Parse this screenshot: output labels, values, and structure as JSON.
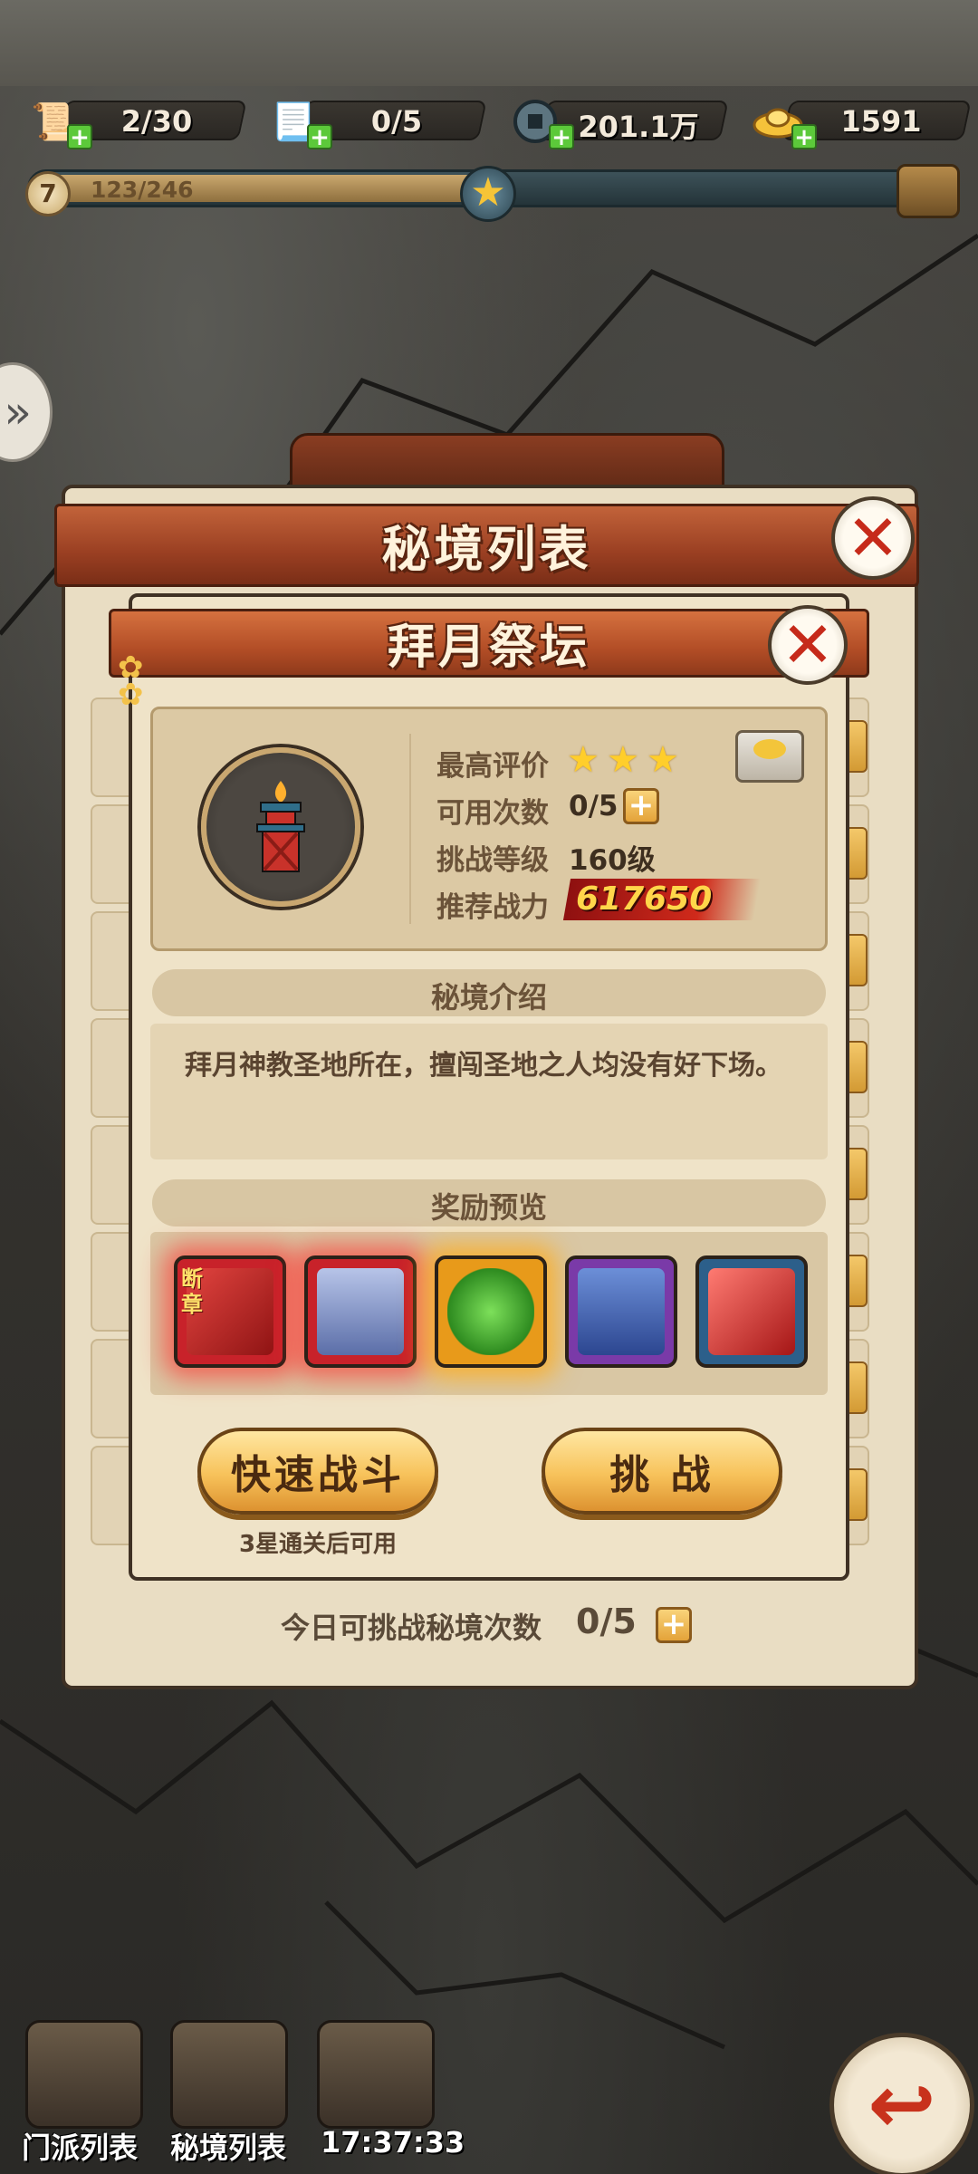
{
  "resources": [
    {
      "icon": "stamina-scroll-icon",
      "value": "2/30"
    },
    {
      "icon": "challenge-scroll-icon",
      "value": "0/5"
    },
    {
      "icon": "copper-coin-icon",
      "value": "201.1万"
    },
    {
      "icon": "gold-ingot-icon",
      "value": "1591"
    }
  ],
  "progress": {
    "level": "7",
    "text": "123/246",
    "fraction": 0.5
  },
  "outer_panel": {
    "title": "秘境列表",
    "daily_label": "今日可挑战秘境次数",
    "daily_count": "0/5"
  },
  "inner_panel": {
    "title": "拜月祭坛",
    "info": {
      "best_rating_label": "最高评价",
      "best_rating_stars": 3,
      "uses_label": "可用次数",
      "uses_value": "0/5",
      "level_label": "挑战等级",
      "level_value": "160级",
      "power_label": "推荐战力",
      "power_value": "617650"
    },
    "intro_title": "秘境介绍",
    "intro_text": "拜月神教圣地所在，擅闯圣地之人均没有好下场。",
    "reward_title": "奖励预览",
    "rewards": [
      {
        "name": "fragment-book-icon",
        "tag": "断章",
        "color": "#c8222a"
      },
      {
        "name": "robe-icon",
        "color": "#c8222a"
      },
      {
        "name": "jade-icon",
        "color": "#e89a1a"
      },
      {
        "name": "blue-chest-icon",
        "color": "#7a3aa8"
      },
      {
        "name": "red-gem-icon",
        "color": "#2c5f8a"
      }
    ],
    "quick_battle_label": "快速战斗",
    "quick_battle_note": "3星通关后可用",
    "challenge_label": "挑 战"
  },
  "bottom": {
    "sect_list_label": "门派列表",
    "realm_list_label": "秘境列表",
    "time": "17:37:33"
  }
}
